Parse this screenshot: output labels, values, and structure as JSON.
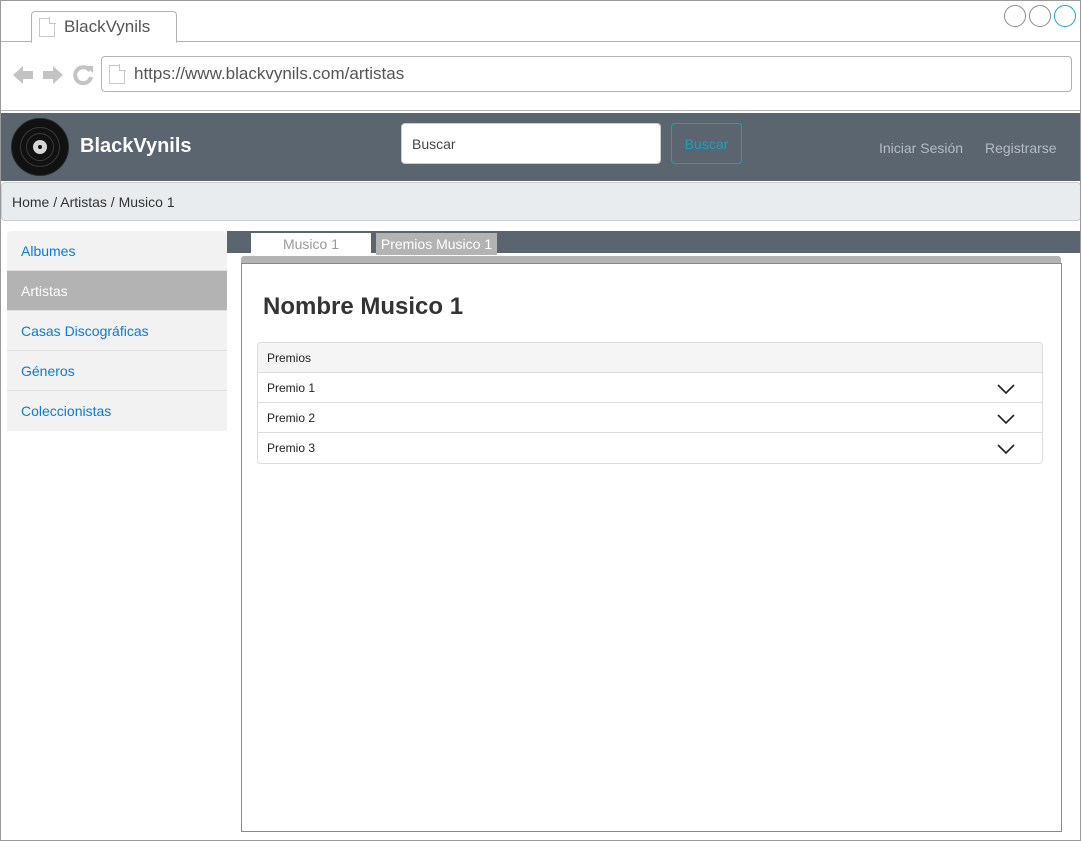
{
  "browser": {
    "tab_title": "BlackVynils",
    "url": "https://www.blackvynils.com/artistas"
  },
  "header": {
    "brand": "BlackVynils",
    "search_placeholder": "Buscar",
    "search_button": "Buscar",
    "login": "Iniciar Sesión",
    "register": "Registrarse"
  },
  "breadcrumb": "Home / Artistas / Musico 1",
  "sidebar": {
    "items": [
      {
        "label": "Albumes"
      },
      {
        "label": "Artistas"
      },
      {
        "label": "Casas Discográficas"
      },
      {
        "label": "Géneros"
      },
      {
        "label": "Coleccionistas"
      }
    ],
    "active": "Artistas"
  },
  "tabs": [
    {
      "label": "Musico 1"
    },
    {
      "label": "Premios Musico 1"
    }
  ],
  "active_tab": "Premios Musico 1",
  "main": {
    "title": "Nombre Musico 1",
    "awards_header": "Premios",
    "awards": [
      {
        "label": "Premio 1"
      },
      {
        "label": "Premio 2"
      },
      {
        "label": "Premio 3"
      }
    ]
  },
  "colors": {
    "header_bg": "#5a6570",
    "link": "#0a7bd8",
    "accent": "#17a2b8",
    "active_item": "#b3b3b3"
  },
  "icons": [
    "page-icon",
    "back-arrow-icon",
    "forward-arrow-icon",
    "reload-icon",
    "vinyl-record-logo",
    "chevron-down-icon"
  ]
}
